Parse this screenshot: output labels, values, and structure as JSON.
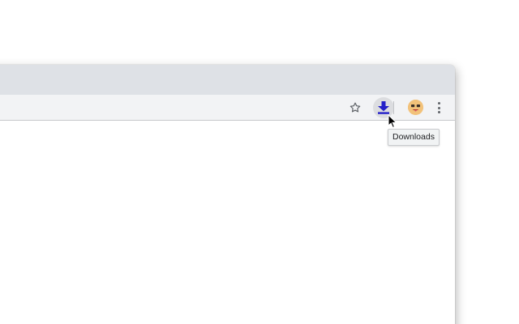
{
  "toolbar": {
    "bookmark_icon": "star-outline-icon",
    "downloads_icon": "download-arrow-icon",
    "profile_icon": "profile-avatar-emoji",
    "menu_icon": "vertical-ellipsis-icon"
  },
  "tooltip": {
    "text": "Downloads"
  },
  "colors": {
    "tab_strip": "#dee1e6",
    "toolbar": "#f2f3f5",
    "download_icon": "#2420c9",
    "avatar": "#f2b66b",
    "icon_gray": "#5f6368"
  }
}
